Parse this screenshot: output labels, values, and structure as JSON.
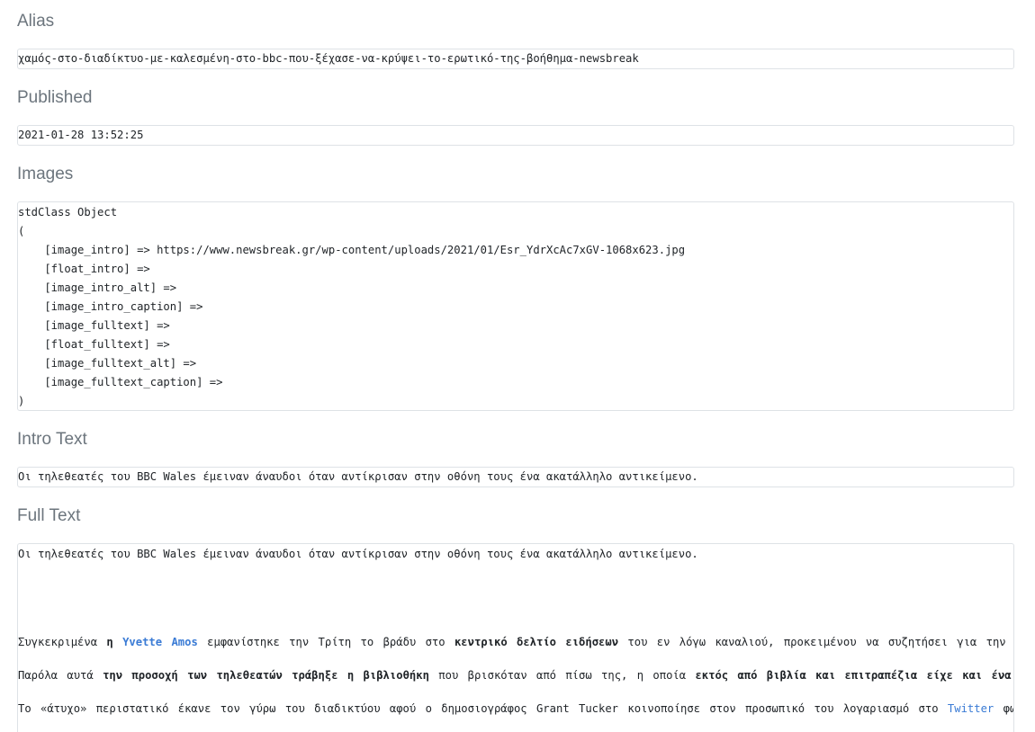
{
  "alias": {
    "label": "Alias",
    "value": "χαμός-στο-διαδίκτυο-με-καλεσμένη-στο-bbc-που-ξέχασε-να-κρύψει-το-ερωτικό-της-βοήθημα-newsbreak"
  },
  "published": {
    "label": "Published",
    "value": "2021-01-28 13:52:25"
  },
  "images": {
    "label": "Images",
    "lines": [
      "stdClass Object",
      "(",
      "    [image_intro] => https://www.newsbreak.gr/wp-content/uploads/2021/01/Esr_YdrXcAc7xGV-1068x623.jpg",
      "    [float_intro] =>",
      "    [image_intro_alt] =>",
      "    [image_intro_caption] =>",
      "    [image_fulltext] =>",
      "    [float_fulltext] =>",
      "    [image_fulltext_alt] =>",
      "    [image_fulltext_caption] =>",
      ")"
    ]
  },
  "intro_text": {
    "label": "Intro Text",
    "value": "Οι τηλεθεατές του BBC Wales έμειναν άναυδοι όταν αντίκρισαν στην οθόνη τους ένα ακατάλληλο αντικείμενο."
  },
  "full_text": {
    "label": "Full Text",
    "first_line": "Οι τηλεθεατές του BBC Wales έμειναν άναυδοι όταν αντίκρισαν στην οθόνη τους ένα ακατάλληλο αντικείμενο.",
    "p1": {
      "t1": "Συγκεκριμένα ",
      "b1": "η ",
      "link1": "Yvette Amos",
      "t2": " εμφανίστηκε την Τρίτη το βράδυ στο ",
      "b2": "κεντρικό δελτίο ειδήσεων",
      "t3": " του εν λόγω καναλιού, προκειμένου να συζητήσει για την αν"
    },
    "p2": {
      "t1": "Παρόλα αυτά ",
      "b1": "την προσοχή των τηλεθεατών τράβηξε η βιβλιοθήκη",
      "t2": " που βρισκόταν από πίσω της, η οποία ",
      "b2": "εκτός από βιβλία και επιτραπέζια είχε και ένα ερ"
    },
    "p3": {
      "t1": "Το «άτυχο» περιστατικό έκανε τον γύρω του διαδικτύου αφού ο δημοσιογράφος Grant Tucker κοινοποίησε στον προσωπικό του λογαριασμό στο ",
      "link1": "Twitter",
      "t2": " φωτ"
    }
  }
}
